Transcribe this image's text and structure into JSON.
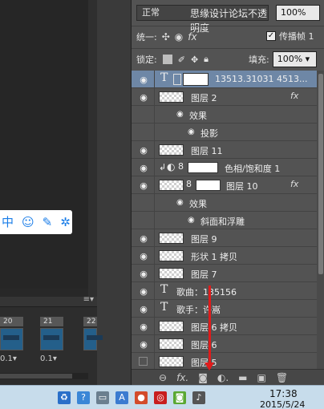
{
  "layers_panel": {
    "blend_mode": "正常",
    "opacity_label": "思缘设计论坛",
    "opacity_overlay": "不透明度",
    "opacity_value": "100%",
    "unify_label": "统一:",
    "propagate_label": "传播帧 1",
    "lock_label": "锁定:",
    "fill_label": "填充:",
    "fill_value": "100%"
  },
  "layers": [
    {
      "name": "13513.31031 4513...",
      "kind": "text",
      "visible": true,
      "selected": true
    },
    {
      "name": "图层 2",
      "kind": "raster",
      "visible": true,
      "fx": true
    },
    {
      "effect_group": "效果"
    },
    {
      "effect": "投影"
    },
    {
      "name": "图层 11",
      "kind": "raster",
      "visible": true
    },
    {
      "name": "色相/饱和度 1",
      "kind": "adjustment",
      "visible": true
    },
    {
      "name": "图层 10",
      "kind": "raster-mask",
      "visible": true,
      "fx": true
    },
    {
      "effect_group": "效果"
    },
    {
      "effect": "斜面和浮雕"
    },
    {
      "name": "图层 9",
      "kind": "raster",
      "visible": true
    },
    {
      "name": "形状 1 拷贝",
      "kind": "raster",
      "visible": true
    },
    {
      "name": "图层 7",
      "kind": "raster",
      "visible": true
    },
    {
      "name": "歌曲：135156",
      "kind": "text",
      "visible": true
    },
    {
      "name": "歌手：许嵩",
      "kind": "text",
      "visible": true
    },
    {
      "name": "图层 6 拷贝",
      "kind": "raster",
      "visible": true
    },
    {
      "name": "图层 6",
      "kind": "raster",
      "visible": true
    },
    {
      "name": "图层 5",
      "kind": "raster",
      "visible": false
    }
  ],
  "fx_label": "fx",
  "timeline": {
    "frames": [
      {
        "num": "20",
        "delay": "0.1▾"
      },
      {
        "num": "21",
        "delay": "0.1▾"
      },
      {
        "num": "22",
        "delay": ""
      }
    ]
  },
  "taskbar": {
    "time": "17:38",
    "date": "2015/5/24"
  }
}
